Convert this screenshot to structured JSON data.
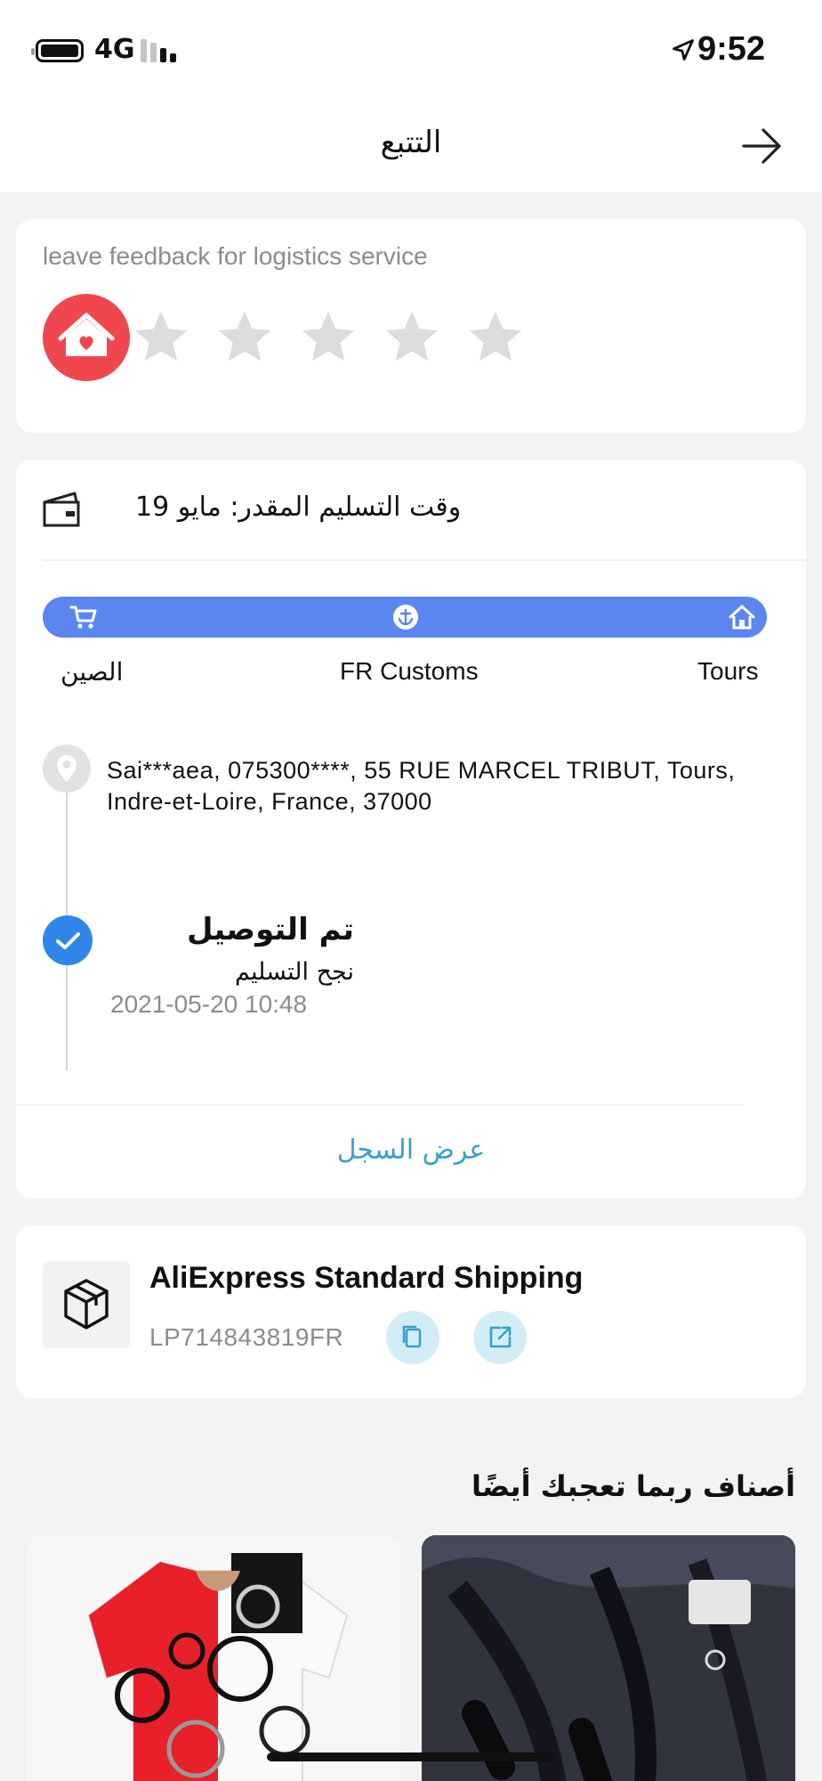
{
  "status_bar": {
    "network": "4G",
    "time": "9:52",
    "battery_icon": "battery-full-icon",
    "signal_icon": "cellular-signal-icon",
    "location_icon": "location-arrow-icon"
  },
  "header": {
    "title": "التتبع",
    "back_icon": "arrow-right-icon"
  },
  "feedback": {
    "title": "leave feedback for logistics service",
    "icon": "house-heart-icon",
    "rating": 0,
    "max_rating": 5
  },
  "delivery": {
    "eta": "وقت التسليم المقدر: مايو 19",
    "eta_icon": "delivery-truck-icon",
    "progress": 1.0,
    "stages": [
      {
        "label": "الصين",
        "icon": "cart-icon"
      },
      {
        "label": "FR Customs",
        "icon": "anchor-icon"
      },
      {
        "label": "Tours",
        "icon": "house-icon"
      }
    ],
    "address": "Sai***aea,  075300****,  55 RUE MARCEL TRIBUT,  Tours,  Indre-et-Loire,  France,  37000",
    "latest_event": {
      "title": "تم التوصيل",
      "subtitle": "نجح التسليم",
      "time": "2021-05-20 10:48"
    },
    "view_history": "عرض السجل"
  },
  "shipping": {
    "method": "AliExpress Standard Shipping",
    "tracking_number": "LP714843819FR",
    "icon": "package-box-icon",
    "copy_icon": "copy-icon",
    "open_icon": "external-link-icon"
  },
  "recommendations": {
    "title": "أصناف ربما تعجبك أيضًا",
    "items": [
      {
        "image": "patterned-tshirt-image"
      },
      {
        "image": "black-harness-image"
      }
    ]
  },
  "colors": {
    "accent_blue": "#5b86f0",
    "check_blue": "#2f86e8",
    "link_teal": "#3aa0c6",
    "feedback_red": "#f0474f"
  }
}
